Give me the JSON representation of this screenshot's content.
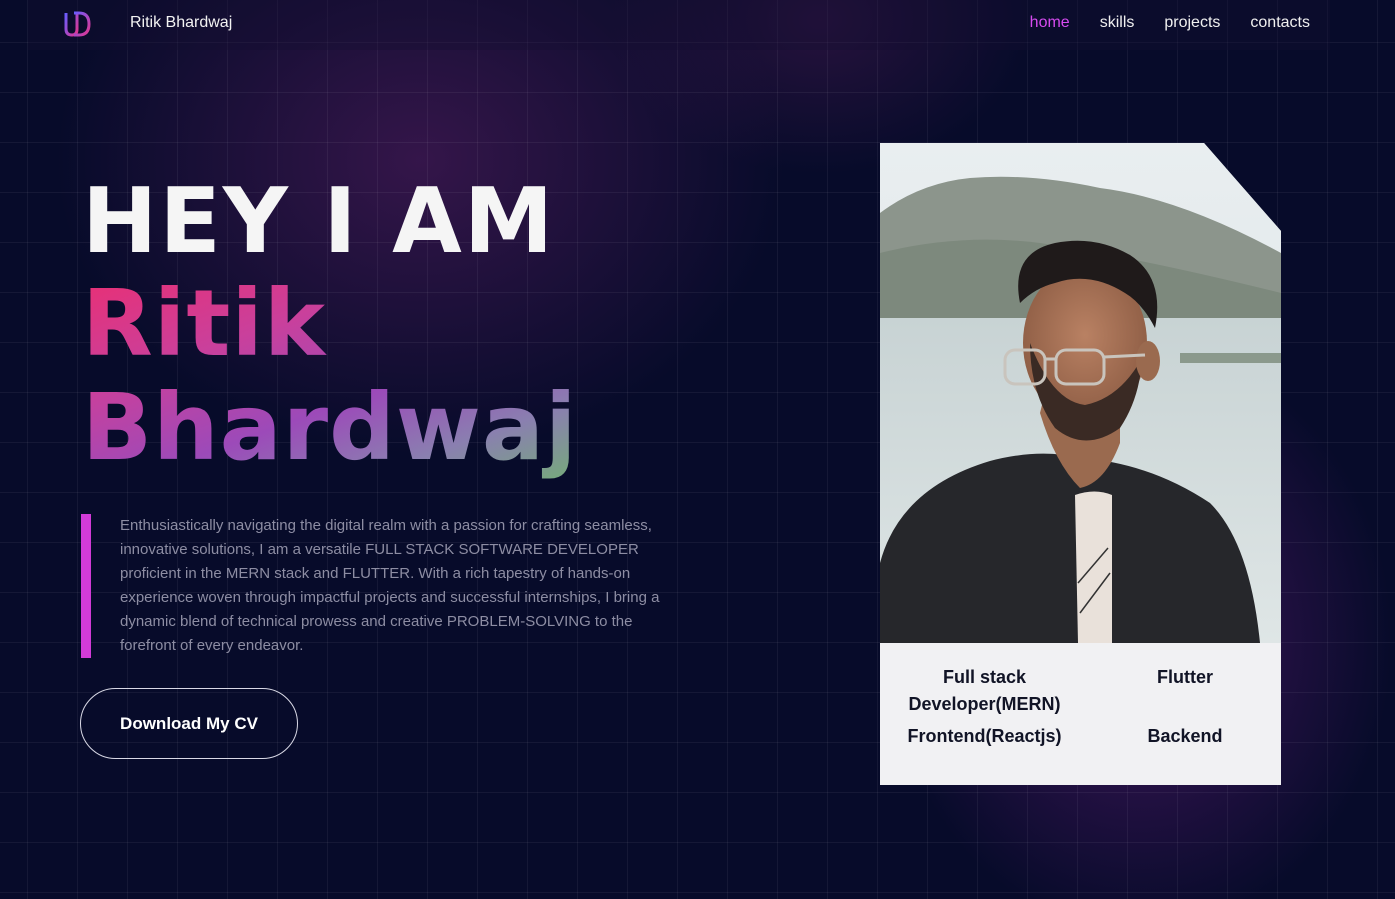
{
  "nav": {
    "logo_icon": "ud-monogram-logo-icon",
    "brand": "Ritik Bhardwaj",
    "links": [
      {
        "label": "home",
        "active": true
      },
      {
        "label": "skills",
        "active": false
      },
      {
        "label": "projects",
        "active": false
      },
      {
        "label": "contacts",
        "active": false
      }
    ],
    "active_color": "#d64bf0"
  },
  "hero": {
    "greeting": "HEY I AM",
    "name_line1": "Ritik",
    "name_line2": "Bhardwaj",
    "intro": "Enthusiastically navigating the digital realm with a passion for crafting seamless, innovative solutions, I am a versatile FULL STACK SOFTWARE DEVELOPER proficient in the MERN stack and FLUTTER. With a rich tapestry of hands-on experience woven through impactful projects and successful internships, I bring a dynamic blend of technical prowess and creative PROBLEM-SOLVING to the forefront of every endeavor.",
    "cv_button": "Download My CV",
    "accent_bar_color": "#d23bd8"
  },
  "card": {
    "photo_alt": "portrait-photo",
    "tags": [
      "Full stack Developer(MERN)",
      "Flutter",
      "Frontend(Reactjs)",
      "Backend"
    ]
  },
  "colors": {
    "background": "#070b2a",
    "name_gradient_start": "#ea2f73",
    "name_gradient_end": "#6fb86a"
  }
}
